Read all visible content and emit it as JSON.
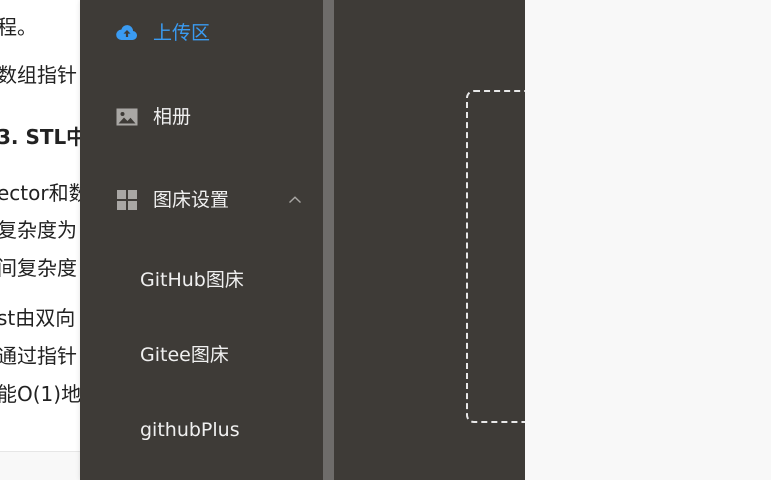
{
  "background_doc": {
    "lines": [
      {
        "text": "程。",
        "bold": false
      },
      {
        "text": "数组指针",
        "bold": false
      },
      {
        "text": "3. STL中",
        "bold": true
      },
      {
        "text": "ector和数",
        "bold": false
      },
      {
        "text": "复杂度为",
        "bold": false
      },
      {
        "text": "间复杂度",
        "bold": false
      },
      {
        "text": "st由双向",
        "bold": false
      },
      {
        "text": "通过指针",
        "bold": false
      },
      {
        "text": "能O(1)地",
        "bold": false
      }
    ]
  },
  "sidebar": {
    "items": [
      {
        "label": "上传区",
        "icon": "cloud-upload-icon",
        "active": true
      },
      {
        "label": "相册",
        "icon": "image-icon",
        "active": false
      },
      {
        "label": "图床设置",
        "icon": "grid-icon",
        "active": false,
        "expanded": true,
        "children": [
          {
            "label": "GitHub图床"
          },
          {
            "label": "Gitee图床"
          },
          {
            "label": "githubPlus"
          }
        ]
      }
    ]
  },
  "colors": {
    "sidebar_bg": "#3e3b37",
    "active": "#3a9bf2",
    "text": "#f0f0f0",
    "icon": "#a9a7a4",
    "divider": "#6e6c6a"
  }
}
